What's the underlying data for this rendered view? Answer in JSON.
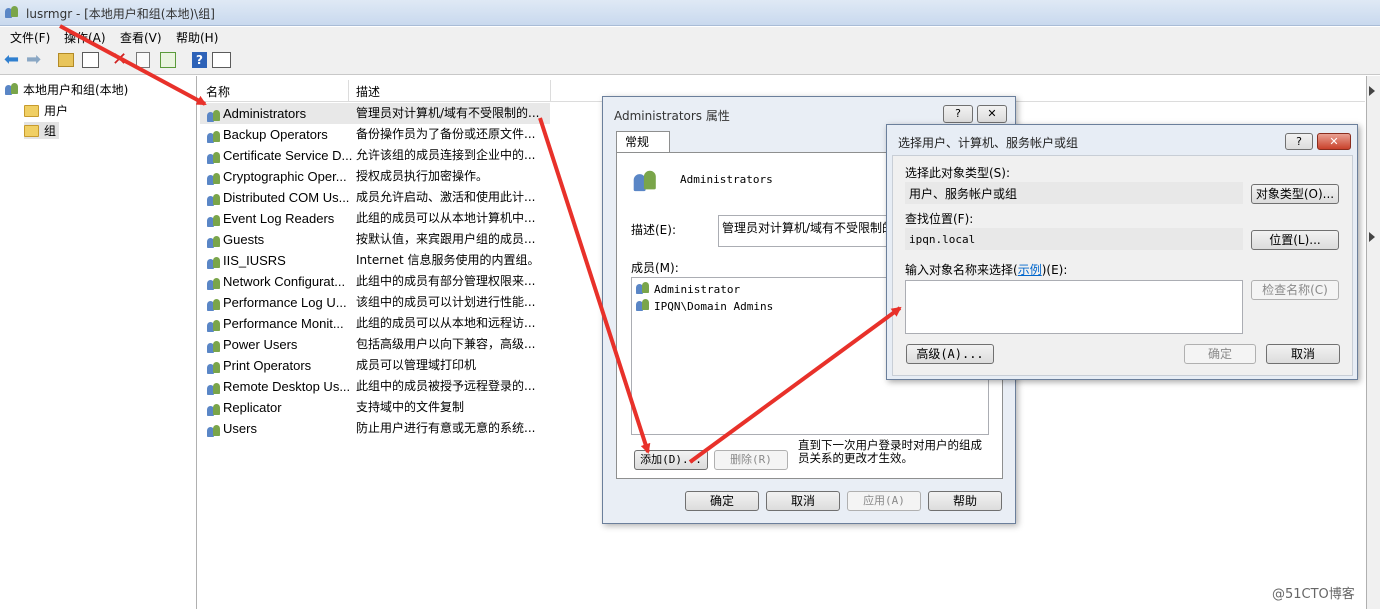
{
  "window": {
    "title": "lusrmgr - [本地用户和组(本地)\\组]"
  },
  "menu": [
    "文件(F)",
    "操作(A)",
    "查看(V)",
    "帮助(H)"
  ],
  "tree": {
    "root": "本地用户和组(本地)",
    "users": "用户",
    "groups": "组"
  },
  "list": {
    "headers": {
      "name": "名称",
      "desc": "描述"
    },
    "rows": [
      {
        "name": "Administrators",
        "desc": "管理员对计算机/域有不受限制的..."
      },
      {
        "name": "Backup Operators",
        "desc": "备份操作员为了备份或还原文件..."
      },
      {
        "name": "Certificate Service D...",
        "desc": "允许该组的成员连接到企业中的..."
      },
      {
        "name": "Cryptographic Oper...",
        "desc": "授权成员执行加密操作。"
      },
      {
        "name": "Distributed COM Us...",
        "desc": "成员允许启动、激活和使用此计..."
      },
      {
        "name": "Event Log Readers",
        "desc": "此组的成员可以从本地计算机中..."
      },
      {
        "name": "Guests",
        "desc": "按默认值，来宾跟用户组的成员..."
      },
      {
        "name": "IIS_IUSRS",
        "desc": "Internet 信息服务使用的内置组。"
      },
      {
        "name": "Network Configurat...",
        "desc": "此组中的成员有部分管理权限来..."
      },
      {
        "name": "Performance Log U...",
        "desc": "该组中的成员可以计划进行性能..."
      },
      {
        "name": "Performance Monit...",
        "desc": "此组的成员可以从本地和远程访..."
      },
      {
        "name": "Power Users",
        "desc": "包括高级用户以向下兼容，高级..."
      },
      {
        "name": "Print Operators",
        "desc": "成员可以管理域打印机"
      },
      {
        "name": "Remote Desktop Us...",
        "desc": "此组中的成员被授予远程登录的..."
      },
      {
        "name": "Replicator",
        "desc": "支持域中的文件复制"
      },
      {
        "name": "Users",
        "desc": "防止用户进行有意或无意的系统..."
      }
    ]
  },
  "props": {
    "title": "Administrators 属性",
    "help": "?",
    "close": "✕",
    "tab": "常规",
    "group_name": "Administrators",
    "desc_label": "描述(E):",
    "desc_value": "管理员对计算机/域有不受限制的",
    "members_label": "成员(M):",
    "members": [
      "Administrator",
      "IPQN\\Domain Admins"
    ],
    "add": "添加(D)...",
    "remove": "删除(R)",
    "note": "直到下一次用户登录时对用户的组成员关系的更改才生效。",
    "ok": "确定",
    "cancel": "取消",
    "apply": "应用(A)",
    "helpbtn": "帮助"
  },
  "select": {
    "title": "选择用户、计算机、服务帐户或组",
    "help": "?",
    "close": "✕",
    "type_label": "选择此对象类型(S):",
    "type_value": "用户、服务帐户或组",
    "type_btn": "对象类型(O)...",
    "loc_label": "查找位置(F):",
    "loc_value": "ipqn.local",
    "loc_btn": "位置(L)...",
    "enter_label": "输入对象名称来选择(",
    "enter_link": "示例",
    "enter_label2": ")(E):",
    "check_btn": "检查名称(C)",
    "adv_btn": "高级(A)...",
    "ok": "确定",
    "cancel": "取消"
  },
  "watermark": "@51CTO博客"
}
